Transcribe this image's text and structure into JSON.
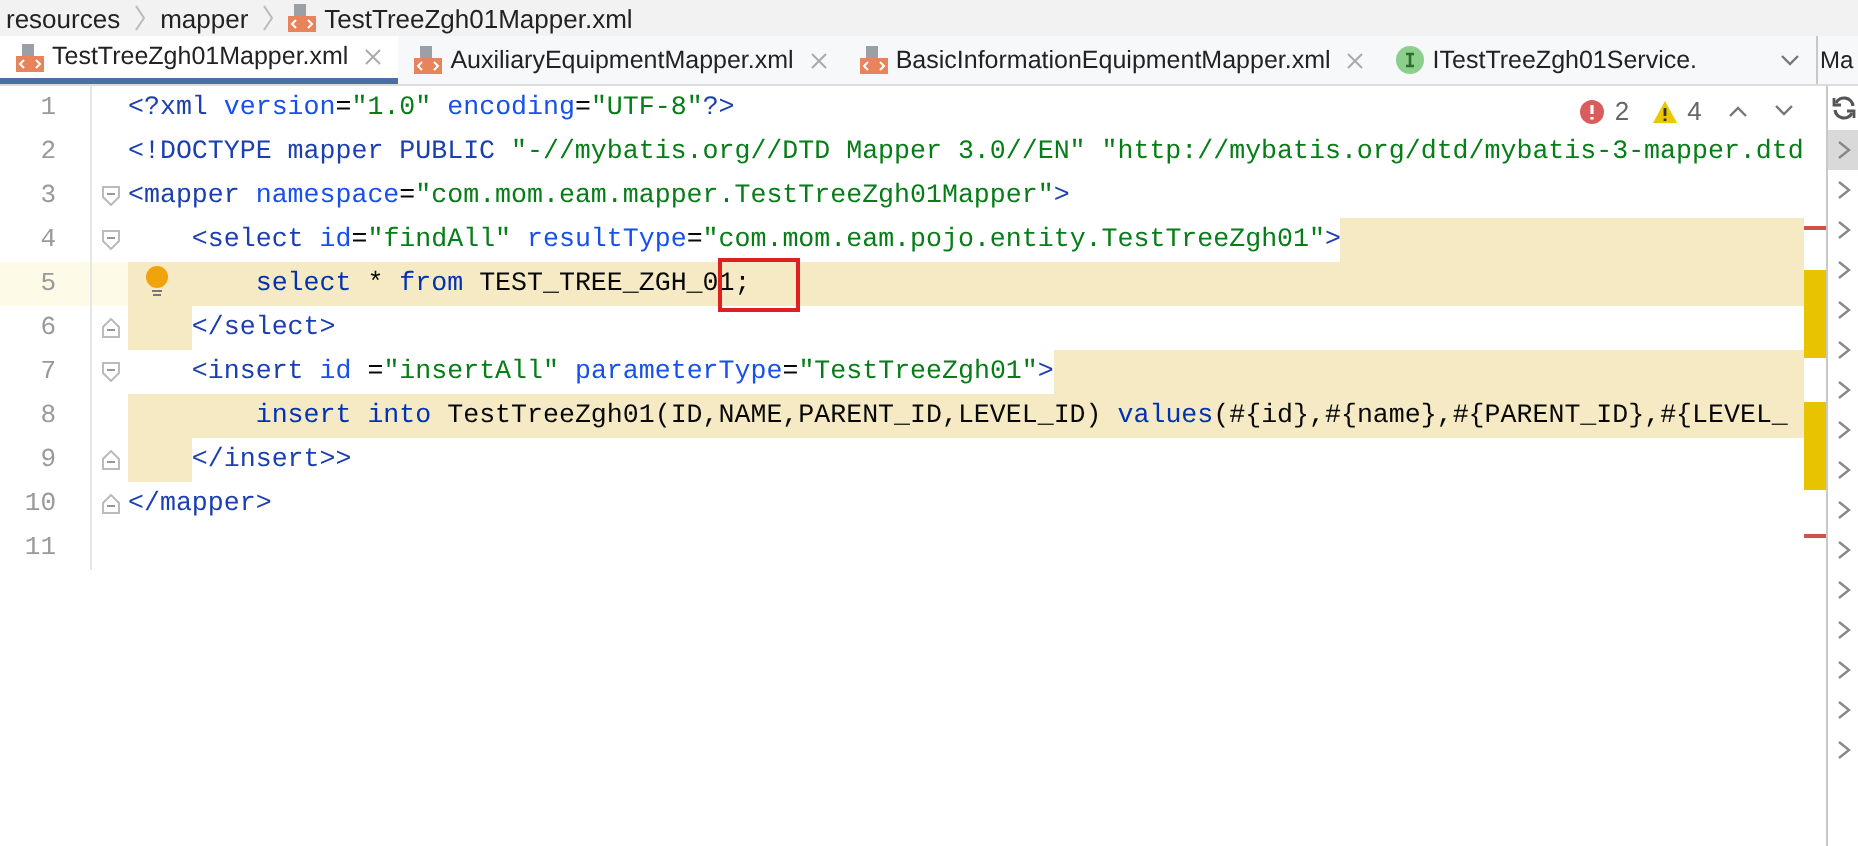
{
  "breadcrumb": [
    {
      "label": "resources",
      "kind": "folder"
    },
    {
      "label": "mapper",
      "kind": "folder"
    },
    {
      "label": "TestTreeZgh01Mapper.xml",
      "kind": "xml"
    }
  ],
  "tabs": [
    {
      "label": "TestTreeZgh01Mapper.xml",
      "kind": "xml",
      "selected": true,
      "closable": true
    },
    {
      "label": "AuxiliaryEquipmentMapper.xml",
      "kind": "xml",
      "selected": false,
      "closable": true
    },
    {
      "label": "BasicInformationEquipmentMapper.xml",
      "kind": "xml",
      "selected": false,
      "closable": true
    },
    {
      "label": "ITestTreeZgh01Service.",
      "kind": "interface",
      "selected": false,
      "closable": false
    }
  ],
  "side_panel": {
    "tab_label": "Ma"
  },
  "problems": {
    "errors": "2",
    "warnings": "4"
  },
  "lines": [
    {
      "number": "1",
      "kind": "plain",
      "tokens": [
        {
          "kind": "tag",
          "t": "<?xml "
        },
        {
          "kind": "attr",
          "t": "version"
        },
        {
          "kind": "plain",
          "t": "="
        },
        {
          "kind": "str",
          "t": "\"1.0\" "
        },
        {
          "kind": "attr",
          "t": "encoding"
        },
        {
          "kind": "plain",
          "t": "="
        },
        {
          "kind": "str",
          "t": "\"UTF-8\""
        },
        {
          "kind": "tag",
          "t": "?>"
        }
      ]
    },
    {
      "number": "2",
      "kind": "plain",
      "tokens": [
        {
          "kind": "tag",
          "t": "<!DOCTYPE mapper PUBLIC "
        },
        {
          "kind": "str",
          "t": "\"-//mybatis.org//DTD Mapper 3.0//EN\" \"http://mybatis.org/dtd/mybatis-3-mapper.dtd"
        }
      ]
    },
    {
      "number": "3",
      "kind": "plain",
      "fold_start": true,
      "tokens": [
        {
          "kind": "tag",
          "t": "<mapper "
        },
        {
          "kind": "attr",
          "t": "namespace"
        },
        {
          "kind": "plain",
          "t": "="
        },
        {
          "kind": "str",
          "t": "\"com.mom.eam.mapper.TestTreeZgh01Mapper\""
        },
        {
          "kind": "tag",
          "t": ">"
        }
      ]
    },
    {
      "number": "4",
      "kind": "tail-band",
      "fold_start": true,
      "tokens": [
        {
          "kind": "tag",
          "t": "    <select "
        },
        {
          "kind": "attr",
          "t": "id"
        },
        {
          "kind": "plain",
          "t": "="
        },
        {
          "kind": "str",
          "t": "\"findAll\" "
        },
        {
          "kind": "attr",
          "t": "resultType"
        },
        {
          "kind": "plain",
          "t": "="
        },
        {
          "kind": "str",
          "t": "\"com.mom.eam.pojo.entity.TestTreeZgh01\""
        },
        {
          "kind": "tag",
          "t": ">"
        }
      ]
    },
    {
      "number": "5",
      "kind": "full-band",
      "current": true,
      "hint": true,
      "tokens": [
        {
          "kind": "kw",
          "t": "        select "
        },
        {
          "kind": "plain",
          "t": "* "
        },
        {
          "kind": "kw",
          "t": "from "
        },
        {
          "kind": "plain",
          "t": "TEST_TREE_ZGH_01;"
        }
      ]
    },
    {
      "number": "6",
      "kind": "indent-band",
      "fold_end": true,
      "tokens": [
        {
          "kind": "tag",
          "t": "    </select>"
        }
      ]
    },
    {
      "number": "7",
      "kind": "tail-band",
      "fold_start": true,
      "tokens": [
        {
          "kind": "tag",
          "t": "    <insert "
        },
        {
          "kind": "attr",
          "t": "id "
        },
        {
          "kind": "plain",
          "t": "="
        },
        {
          "kind": "str",
          "t": "\"insertAll\" "
        },
        {
          "kind": "attr",
          "t": "parameterType"
        },
        {
          "kind": "plain",
          "t": "="
        },
        {
          "kind": "str",
          "t": "\"TestTreeZgh01\""
        },
        {
          "kind": "tag",
          "t": ">"
        }
      ]
    },
    {
      "number": "8",
      "kind": "full-band",
      "tokens": [
        {
          "kind": "kw",
          "t": "        insert into "
        },
        {
          "kind": "plain",
          "t": "TestTreeZgh01(ID,NAME,PARENT_ID,LEVEL_ID) "
        },
        {
          "kind": "kw",
          "t": "values"
        },
        {
          "kind": "plain",
          "t": "(#{id},#{name},#{PARENT_ID},#{LEVEL_"
        }
      ]
    },
    {
      "number": "9",
      "kind": "indent-band",
      "fold_end": true,
      "tokens": [
        {
          "kind": "tag",
          "t": "    </insert>>"
        }
      ]
    },
    {
      "number": "10",
      "kind": "plain",
      "fold_end": true,
      "tokens": [
        {
          "kind": "tag",
          "t": "</mapper>"
        }
      ]
    },
    {
      "number": "11",
      "kind": "plain"
    }
  ]
}
